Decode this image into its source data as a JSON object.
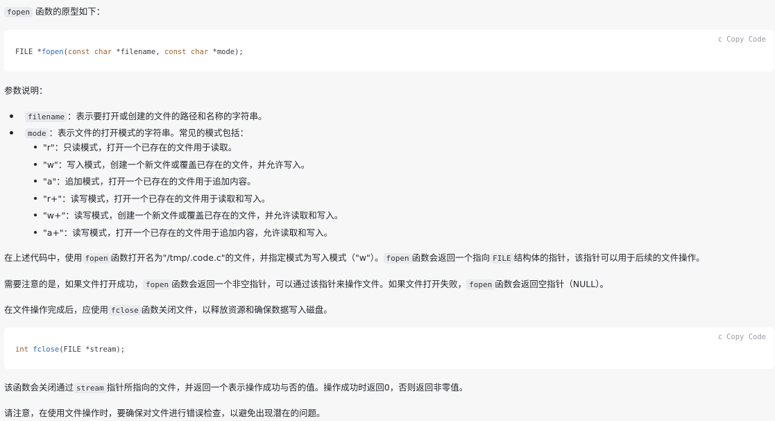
{
  "intro": {
    "code": "fopen",
    "text": "函数的原型如下："
  },
  "code_block_1": {
    "lang": "c",
    "copy_label": "Copy Code",
    "parts": {
      "t1": "FILE *",
      "fn": "fopen",
      "t2": "(",
      "k1": "const char",
      "t3": " *filename, ",
      "k2": "const char",
      "t4": " *mode);"
    }
  },
  "params_heading": "参数说明：",
  "params": [
    {
      "code": "filename",
      "text": "：表示要打开或创建的文件的路径和名称的字符串。"
    },
    {
      "code": "mode",
      "text": "：表示文件的打开模式的字符串。常见的模式包括："
    }
  ],
  "modes": [
    "\"r\"：只读模式，打开一个已存在的文件用于读取。",
    "\"w\"：写入模式，创建一个新文件或覆盖已存在的文件，并允许写入。",
    "\"a\"：追加模式，打开一个已存在的文件用于追加内容。",
    "\"r+\"：读写模式，打开一个已存在的文件用于读取和写入。",
    "\"w+\"：读写模式，创建一个新文件或覆盖已存在的文件，并允许读取和写入。",
    "\"a+\"：读写模式，打开一个已存在的文件用于追加内容，允许读取和写入。"
  ],
  "para1": {
    "t1": "在上述代码中，使用",
    "c1": "fopen",
    "t2": "函数打开名为\"/tmp/.code.c\"的文件，并指定模式为写入模式（\"w\"）。",
    "c2": "fopen",
    "t3": "函数会返回一个指向",
    "c3": "FILE",
    "t4": "结构体的指针，该指针可以用于后续的文件操作。"
  },
  "para2": {
    "t1": "需要注意的是，如果文件打开成功，",
    "c1": "fopen",
    "t2": "函数会返回一个非空指针，可以通过该指针来操作文件。如果文件打开失败，",
    "c2": "fopen",
    "t3": "函数会返回空指针（NULL）。"
  },
  "para3": {
    "t1": "在文件操作完成后，应使用",
    "c1": "fclose",
    "t2": "函数关闭文件，以释放资源和确保数据写入磁盘。"
  },
  "code_block_2": {
    "lang": "c",
    "copy_label": "Copy Code",
    "parts": {
      "k1": "int",
      "t1": " ",
      "fn": "fclose",
      "t2": "(FILE *stream);"
    }
  },
  "para4": {
    "t1": "该函数会关闭通过",
    "c1": "stream",
    "t2": "指针所指向的文件，并返回一个表示操作成功与否的值。操作成功时返回0，否则返回非零值。"
  },
  "para5": "请注意，在使用文件操作时，要确保对文件进行错误检查，以避免出现潜在的问题。"
}
